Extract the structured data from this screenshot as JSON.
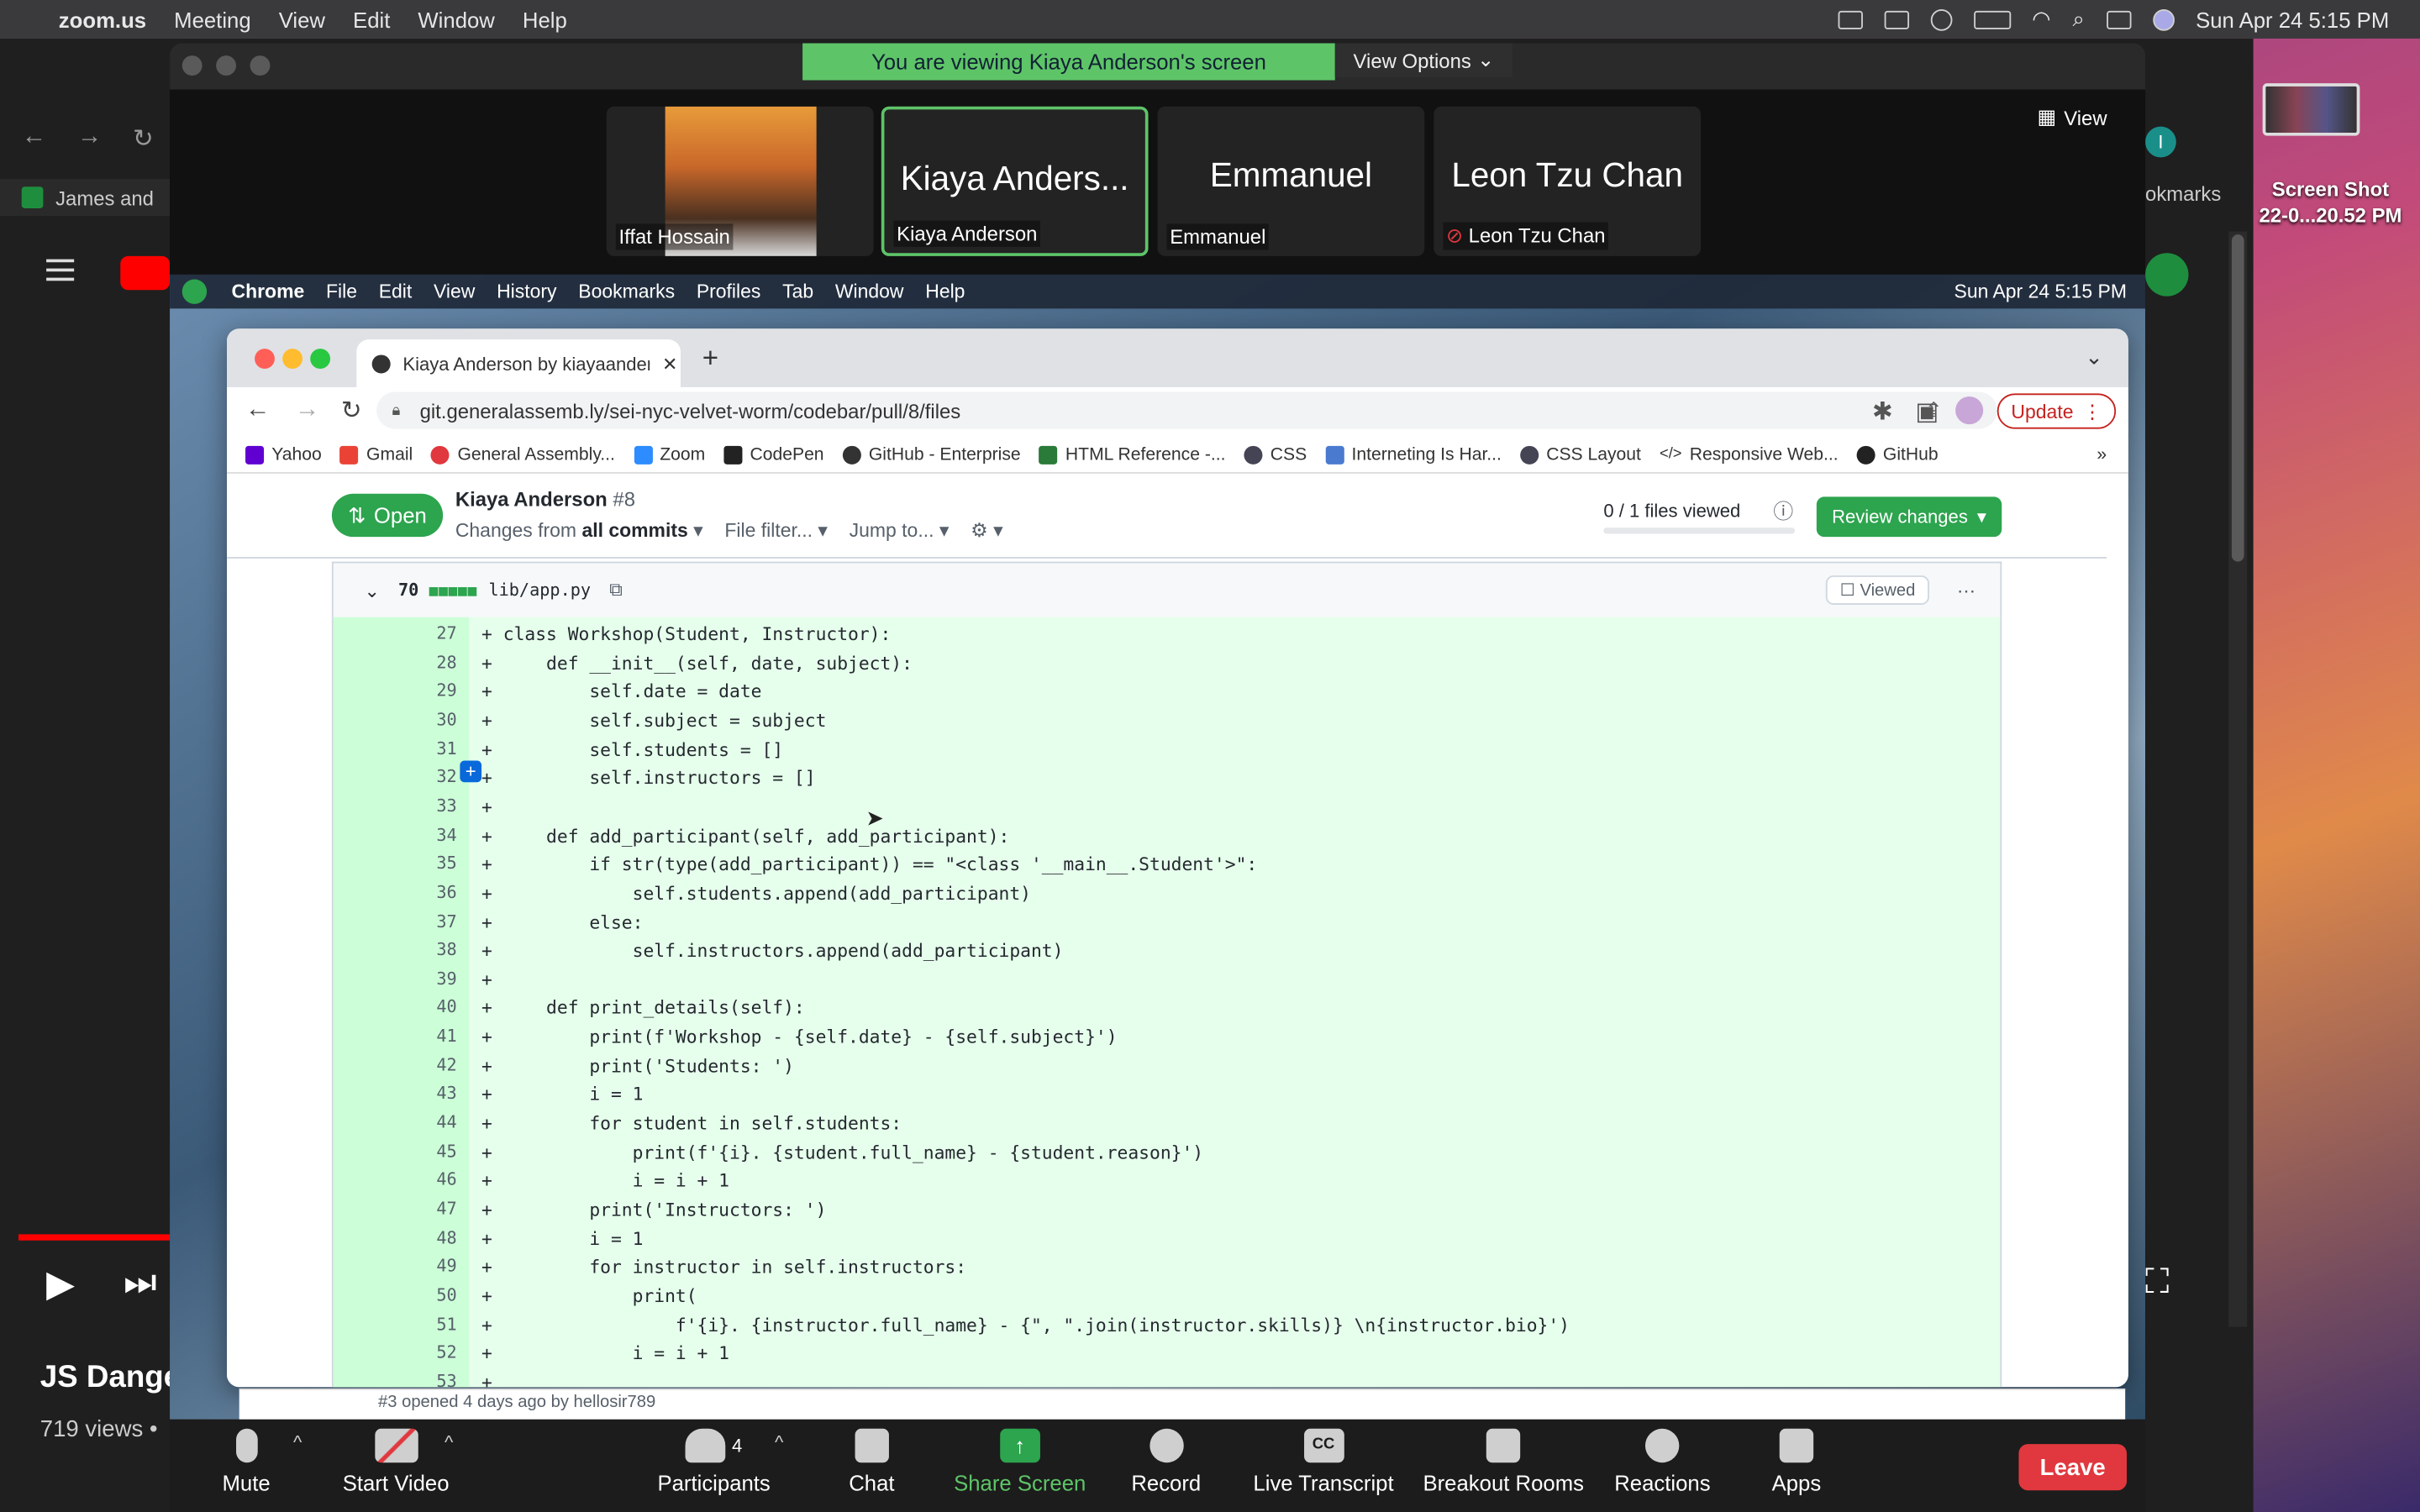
{
  "mac_menubar": {
    "app": "zoom.us",
    "items": [
      "Meeting",
      "View",
      "Edit",
      "Window",
      "Help"
    ],
    "datetime": "Sun Apr 24  5:15 PM"
  },
  "desktop": {
    "screenshot_label": "Screen Shot\n22-0...20.52 PM"
  },
  "background_browser": {
    "bookmark_left": "James and",
    "bookmarks_right": "okmarks",
    "avatar_letter": "I",
    "video_title": "JS Dange",
    "video_views": "719 views •"
  },
  "zoom": {
    "banner": "You are viewing Kiaya Anderson's screen",
    "view_options": "View Options",
    "view_button": "View",
    "participants": [
      {
        "name": "Iffat Hossain",
        "big": ""
      },
      {
        "name": "Kiaya Anderson",
        "big": "Kiaya Anders..."
      },
      {
        "name": "Emmanuel",
        "big": "Emmanuel"
      },
      {
        "name": "Leon Tzu Chan",
        "big": "Leon Tzu Chan"
      }
    ],
    "toolbar": {
      "mute": "Mute",
      "start_video": "Start Video",
      "participants": "Participants",
      "participants_count": "4",
      "chat": "Chat",
      "share_screen": "Share Screen",
      "record": "Record",
      "live_transcript": "Live Transcript",
      "breakout_rooms": "Breakout Rooms",
      "reactions": "Reactions",
      "apps": "Apps",
      "leave": "Leave"
    }
  },
  "shared": {
    "menubar": {
      "app": "Chrome",
      "items": [
        "File",
        "Edit",
        "View",
        "History",
        "Bookmarks",
        "Profiles",
        "Tab",
        "Window",
        "Help"
      ],
      "datetime": "Sun Apr 24  5:15 PM"
    },
    "tab_title": "Kiaya Anderson by kiayaanders",
    "url": "git.generalassemb.ly/sei-nyc-velvet-worm/codebar/pull/8/files",
    "update_label": "Update",
    "bookmarks": [
      "Yahoo",
      "Gmail",
      "General Assembly...",
      "Zoom",
      "CodePen",
      "GitHub - Enterprise",
      "HTML Reference -...",
      "CSS",
      "Interneting Is Har...",
      "CSS Layout",
      "Responsive Web...",
      "GitHub"
    ],
    "pr": {
      "state": "Open",
      "author": "Kiaya Anderson",
      "number": "#8",
      "changes_from": "Changes from",
      "all_commits": "all commits",
      "file_filter": "File filter...",
      "jump_to": "Jump to...",
      "files_viewed": "0 / 1 files viewed",
      "review_changes": "Review changes",
      "file_changes": "70",
      "file_name": "lib/app.py",
      "viewed": "Viewed",
      "footer_text": "#3 opened 4 days ago by hellosir789"
    },
    "code_lines": [
      {
        "n": "27",
        "t": "class Workshop(Student, Instructor):"
      },
      {
        "n": "28",
        "t": "    def __init__(self, date, subject):"
      },
      {
        "n": "29",
        "t": "        self.date = date"
      },
      {
        "n": "30",
        "t": "        self.subject = subject"
      },
      {
        "n": "31",
        "t": "        self.students = []"
      },
      {
        "n": "32",
        "t": "        self.instructors = []"
      },
      {
        "n": "33",
        "t": ""
      },
      {
        "n": "34",
        "t": "    def add_participant(self, add_participant):"
      },
      {
        "n": "35",
        "t": "        if str(type(add_participant)) == \"<class '__main__.Student'>\":"
      },
      {
        "n": "36",
        "t": "            self.students.append(add_participant)"
      },
      {
        "n": "37",
        "t": "        else:"
      },
      {
        "n": "38",
        "t": "            self.instructors.append(add_participant)"
      },
      {
        "n": "39",
        "t": ""
      },
      {
        "n": "40",
        "t": "    def print_details(self):"
      },
      {
        "n": "41",
        "t": "        print(f'Workshop - {self.date} - {self.subject}')"
      },
      {
        "n": "42",
        "t": "        print('Students: ')"
      },
      {
        "n": "43",
        "t": "        i = 1"
      },
      {
        "n": "44",
        "t": "        for student in self.students:"
      },
      {
        "n": "45",
        "t": "            print(f'{i}. {student.full_name} - {student.reason}')"
      },
      {
        "n": "46",
        "t": "            i = i + 1"
      },
      {
        "n": "47",
        "t": "        print('Instructors: ')"
      },
      {
        "n": "48",
        "t": "        i = 1"
      },
      {
        "n": "49",
        "t": "        for instructor in self.instructors:"
      },
      {
        "n": "50",
        "t": "            print("
      },
      {
        "n": "51",
        "t": "                f'{i}. {instructor.full_name} - {\", \".join(instructor.skills)} \\n{instructor.bio}')"
      },
      {
        "n": "52",
        "t": "            i = i + 1"
      },
      {
        "n": "53",
        "t": ""
      }
    ]
  },
  "colors": {
    "zoom_green": "#5ec468",
    "github_green": "#2da44e",
    "leave_red": "#e0383e"
  }
}
